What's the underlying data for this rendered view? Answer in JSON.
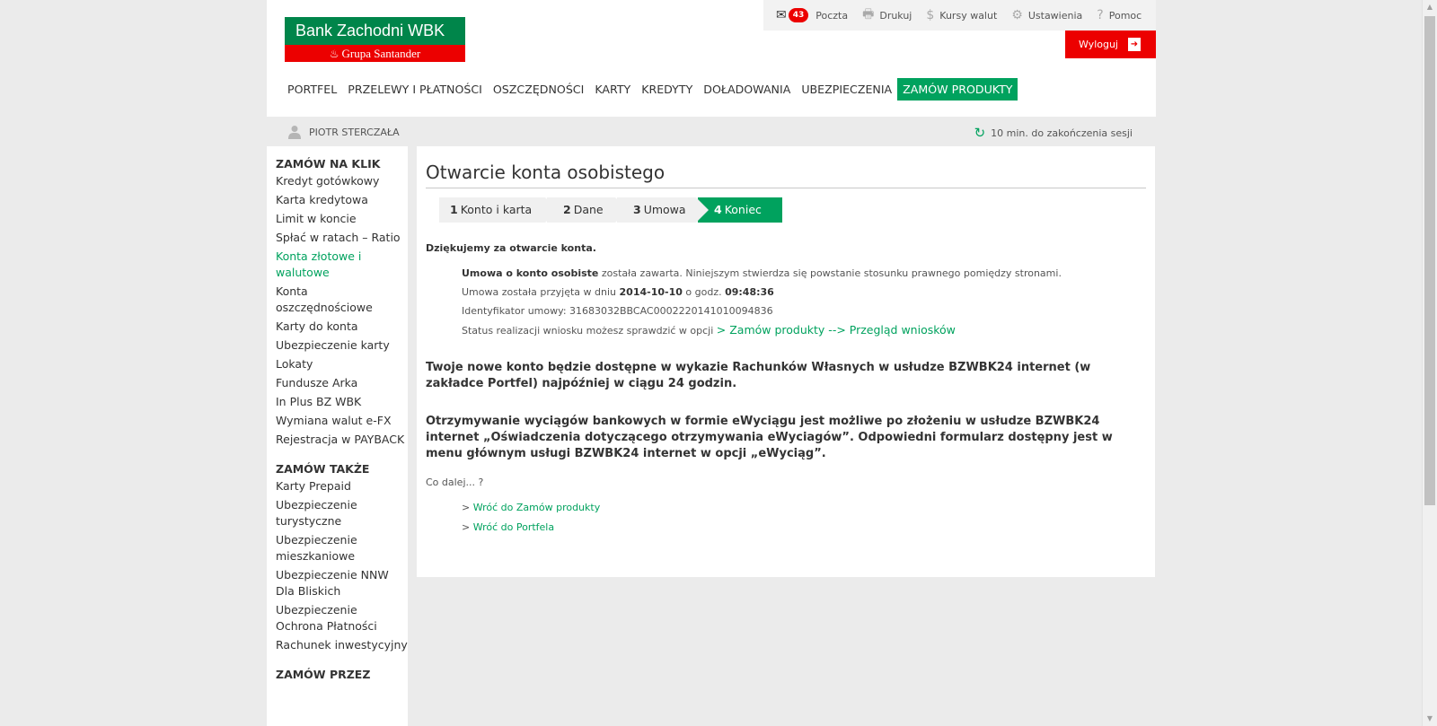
{
  "logo": {
    "name": "Bank Zachodni WBK",
    "group": "Grupa Santander"
  },
  "utility": {
    "mail_count": "43",
    "mail": "Poczta",
    "print": "Drukuj",
    "rates": "Kursy walut",
    "settings": "Ustawienia",
    "help": "Pomoc"
  },
  "logout": "Wyloguj",
  "nav": [
    "PORTFEL",
    "PRZELEWY I PŁATNOŚCI",
    "OSZCZĘDNOŚCI",
    "KARTY",
    "KREDYTY",
    "DOŁADOWANIA",
    "UBEZPIECZENIA",
    "ZAMÓW PRODUKTY"
  ],
  "user": {
    "name": "PIOTR STERCZAŁA",
    "session": "10 min. do zakończenia sesji"
  },
  "sidebar": {
    "heading1": "ZAMÓW NA KLIK",
    "group1": [
      "Kredyt gotówkowy",
      "Karta kredytowa",
      "Limit w koncie",
      "Spłać w ratach – Ratio",
      "Konta złotowe i walutowe",
      "Konta oszczędnościowe",
      "Karty do konta",
      "Ubezpieczenie karty",
      "Lokaty",
      "Fundusze Arka",
      "In Plus BZ WBK",
      "Wymiana walut e-FX",
      "Rejestracja w PAYBACK"
    ],
    "heading2": "ZAMÓW TAKŻE",
    "group2": [
      "Karty Prepaid",
      "Ubezpieczenie turystyczne",
      "Ubezpieczenie mieszkaniowe",
      "Ubezpieczenie NNW Dla Bliskich",
      "Ubezpieczenie Ochrona Płatności",
      "Rachunek inwestycyjny"
    ],
    "heading3": "ZAMÓW PRZEZ"
  },
  "content": {
    "title": "Otwarcie konta osobistego",
    "steps": [
      {
        "num": "1",
        "label": "Konto i karta"
      },
      {
        "num": "2",
        "label": "Dane"
      },
      {
        "num": "3",
        "label": "Umowa"
      },
      {
        "num": "4",
        "label": "Koniec"
      }
    ],
    "thanks": "Dziękujemy za otwarcie konta.",
    "contract_bold": "Umowa o konto osobiste",
    "contract_rest": " została zawarta. Niniejszym stwierdza się powstanie stosunku prawnego pomiędzy stronami.",
    "accepted_prefix": "Umowa została przyjęta w dniu ",
    "accepted_date": "2014-10-10",
    "accepted_mid": " o godz. ",
    "accepted_time": "09:48:36",
    "identifier": "Identyfikator umowy: 31683032BBCAC0002220141010094836",
    "status_text": "Status realizacji wniosku możesz sprawdzić w opcji ",
    "status_link": "> Zamów produkty --> Przegląd wniosków",
    "notice1": "Twoje nowe konto będzie dostępne w wykazie Rachunków Własnych w usłudze BZWBK24 internet (w zakładce Portfel) najpóźniej w ciągu 24 godzin.",
    "notice2": "Otrzymywanie wyciągów bankowych w formie eWyciągu jest możliwe po złożeniu w usłudze BZWBK24 internet „Oświadczenia dotyczącego otrzymywania eWyciagów”. Odpowiedni formularz dostępny jest w menu głównym usługi BZWBK24 internet w opcji „eWyciąg”.",
    "whats_next": "Co dalej... ?",
    "link1": "Wróć do Zamów produkty",
    "link2": "Wróć do Portfela"
  },
  "colors": {
    "green": "#00a25e",
    "red": "#ec0000"
  }
}
